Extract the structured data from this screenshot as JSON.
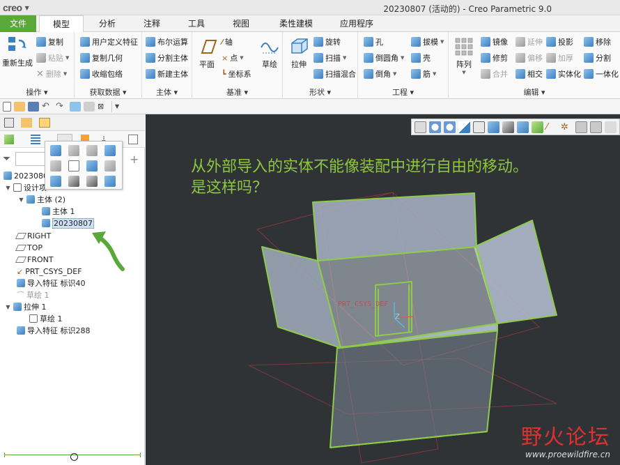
{
  "app": {
    "logo": "creo",
    "title": "20230807 (活动的) - Creo Parametric 9.0"
  },
  "ribbon_tabs": [
    {
      "label": "文件"
    },
    {
      "label": "模型"
    },
    {
      "label": "分析"
    },
    {
      "label": "注释"
    },
    {
      "label": "工具"
    },
    {
      "label": "视图"
    },
    {
      "label": "柔性建模"
    },
    {
      "label": "应用程序"
    }
  ],
  "groups": {
    "operations": {
      "label": "操作 ▾",
      "regen": "重新生成",
      "copy": "复制",
      "paste": "粘贴",
      "delete": "删除"
    },
    "get_data": {
      "label": "获取数据 ▾",
      "udf": "用户定义特征",
      "copy_geom": "复制几何",
      "shrinkwrap": "收缩包络"
    },
    "body": {
      "label": "主体 ▾",
      "boolean": "布尔运算",
      "split": "分割主体",
      "new_body": "新建主体"
    },
    "datum": {
      "label": "基准 ▾",
      "plane": "平面",
      "axis": "轴",
      "point": "点",
      "csys": "坐标系",
      "sketch": "草绘"
    },
    "shapes": {
      "label": "形状 ▾",
      "extrude": "拉伸",
      "revolve": "旋转",
      "sweep": "扫描",
      "swept_blend": "扫描混合"
    },
    "engineering": {
      "label": "工程 ▾",
      "hole": "孔",
      "round": "倒圆角",
      "chamfer": "倒角",
      "draft": "拔模",
      "shell": "壳",
      "rib": "筋"
    },
    "editing": {
      "label": "编辑 ▾",
      "pattern": "阵列",
      "mirror": "镜像",
      "trim": "修剪",
      "merge": "合并",
      "extend": "延伸",
      "offset": "偏移",
      "intersect": "相交",
      "project": "投影",
      "thicken": "加厚",
      "solidify": "实体化",
      "remove": "移除",
      "split": "分割",
      "unify": "一体化"
    }
  },
  "model_tree": {
    "root": "20230807",
    "items": [
      {
        "label": "设计项",
        "indent": 1
      },
      {
        "label": "主体 (2)",
        "indent": 2
      },
      {
        "label": "主体 1",
        "indent": 3
      },
      {
        "label": "20230807",
        "indent": 3,
        "selected": true
      },
      {
        "label": "RIGHT",
        "indent": 1
      },
      {
        "label": "TOP",
        "indent": 1
      },
      {
        "label": "FRONT",
        "indent": 1
      },
      {
        "label": "PRT_CSYS_DEF",
        "indent": 1
      },
      {
        "label": "导入特征 标识40",
        "indent": 1
      },
      {
        "label": "草绘 1",
        "indent": 1,
        "dim": true
      },
      {
        "label": "拉伸 1",
        "indent": 1
      },
      {
        "label": "草绘 1",
        "indent": 2
      },
      {
        "label": "导入特征 标识288",
        "indent": 1
      }
    ]
  },
  "graphics": {
    "annotation_line1": "从外部导入的实体不能像装配中进行自由的移动。",
    "annotation_line2": "是这样吗？",
    "csys_label": "PRT_CSYS_DEF",
    "axis_z": "Z",
    "annotation_color": "#8dc63f",
    "background_color": "#2f3336"
  },
  "watermark": {
    "title": "野火论坛",
    "url": "www.proewildfire.cn"
  },
  "colors": {
    "file_tab": "#5aa83a",
    "selection": "#cfe3f7",
    "watermark_red": "#e03131"
  }
}
